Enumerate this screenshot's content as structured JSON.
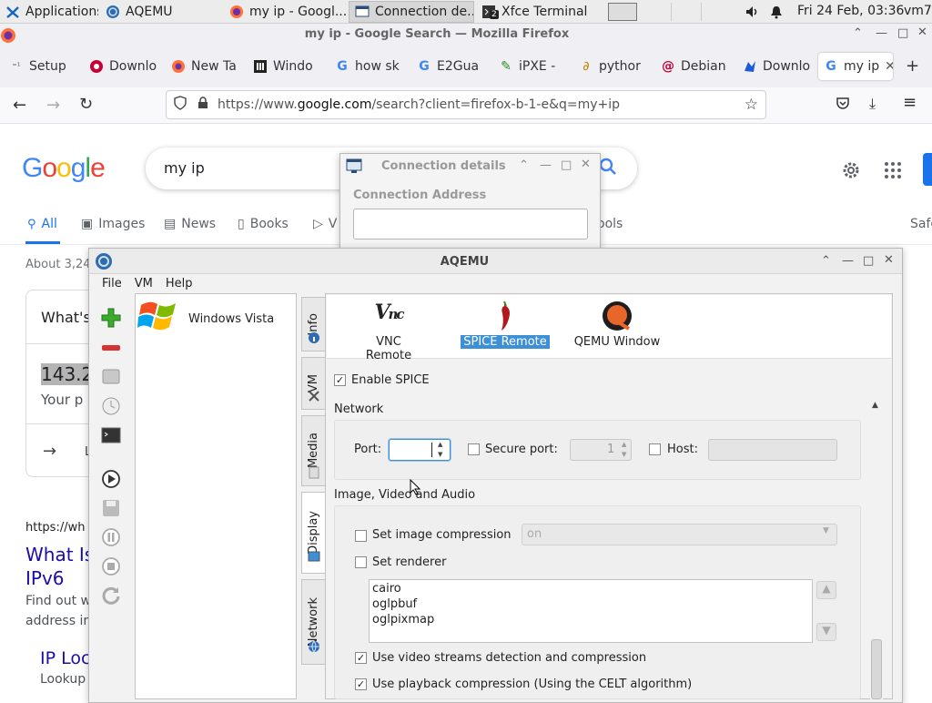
{
  "panel": {
    "apps_label": "Applications",
    "tasks": [
      {
        "label": "AQEMU"
      },
      {
        "label": "my ip - Googl..."
      },
      {
        "label": "Connection de..."
      },
      {
        "label": "Xfce Terminal"
      }
    ],
    "term_badge": "2",
    "clock": "Fri 24 Feb, 03:36",
    "user": "vm7"
  },
  "firefox": {
    "window_title": "my ip - Google Search — Mozilla Firefox",
    "tabs": [
      {
        "label": "Setup"
      },
      {
        "label": "Downlo"
      },
      {
        "label": "New Ta"
      },
      {
        "label": "Windo"
      },
      {
        "label": "how sk"
      },
      {
        "label": "E2Gua"
      },
      {
        "label": "iPXE -"
      },
      {
        "label": "pythor"
      },
      {
        "label": "Debian"
      },
      {
        "label": "Downlo"
      },
      {
        "label": "my ip"
      }
    ],
    "url_prefix": "https://www.",
    "url_domain": "google.com",
    "url_rest": "/search?client=firefox-b-1-e&q=my+ip"
  },
  "google": {
    "logo": "Google",
    "query": "my ip",
    "tabs": [
      "All",
      "Images",
      "News",
      "Books",
      "V",
      "ools"
    ],
    "safe": "Safe",
    "about": "About 3,24",
    "whats": "What's",
    "ip_partial": "143.2",
    "your_p": "Your p",
    "l_partial": "L",
    "url_line": "https://wh",
    "result_title_1": "What Is",
    "result_title_2": "IPv6",
    "snip_1": "Find out w",
    "snip_2": "address in",
    "ip_loc": "IP Loc",
    "lookup": "Lookup"
  },
  "conn_dialog": {
    "title": "Connection details",
    "address_label": "Connection Address",
    "address_value": ""
  },
  "aqemu": {
    "title": "AQEMU",
    "menu": [
      "File",
      "VM",
      "Help"
    ],
    "vm_name": "Windows Vista",
    "side_tabs": [
      "Info",
      "VM",
      "Media",
      "Display",
      "Network"
    ],
    "modes": [
      {
        "label": "VNC Remote",
        "selected": false
      },
      {
        "label": "SPICE Remote",
        "selected": true
      },
      {
        "label": "QEMU Window",
        "selected": false
      }
    ],
    "enable_spice": "Enable SPICE",
    "network_label": "Network",
    "port_label": "Port:",
    "port_value": "",
    "secure_port_label": "Secure port:",
    "secure_port_value": "1",
    "host_label": "Host:",
    "host_value": "",
    "iva_label": "Image, Video and Audio",
    "img_comp_label": "Set image compression",
    "img_comp_value": "on",
    "renderer_label": "Set renderer",
    "renderers": [
      "cairo",
      "oglpbuf",
      "oglpixmap"
    ],
    "video_label": "Use video streams detection and compression",
    "playback_label": "Use playback compression (Using the CELT algorithm)"
  },
  "colors": {
    "selection": "#3d8fd6",
    "google_blue": "#1a0dab",
    "panel": "#ececec"
  }
}
